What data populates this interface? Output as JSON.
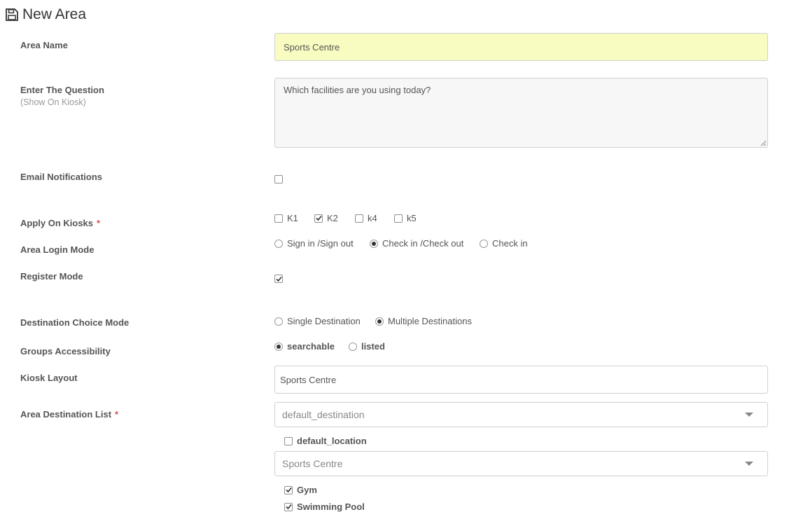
{
  "page": {
    "title": "New Area",
    "icon": "floppy-disk-icon"
  },
  "fields": {
    "area_name": {
      "label": "Area Name",
      "value": "Sports Centre"
    },
    "question": {
      "label": "Enter The Question",
      "sublabel": "(Show On Kiosk)",
      "value": "Which facilities are you using today?"
    },
    "email_notifications": {
      "label": "Email Notifications",
      "checked": false
    },
    "apply_on_kiosks": {
      "label": "Apply On Kiosks",
      "required_mark": "*",
      "options": [
        {
          "label": "K1",
          "checked": false
        },
        {
          "label": "K2",
          "checked": true
        },
        {
          "label": "k4",
          "checked": false
        },
        {
          "label": "k5",
          "checked": false
        }
      ]
    },
    "area_login_mode": {
      "label": "Area Login Mode",
      "options": [
        {
          "label": "Sign in /Sign out",
          "selected": false
        },
        {
          "label": "Check in /Check out",
          "selected": true
        },
        {
          "label": "Check in",
          "selected": false
        }
      ]
    },
    "register_mode": {
      "label": "Register Mode",
      "checked": true
    },
    "destination_choice_mode": {
      "label": "Destination Choice Mode",
      "options": [
        {
          "label": "Single Destination",
          "selected": false
        },
        {
          "label": "Multiple Destinations",
          "selected": true
        }
      ]
    },
    "groups_accessibility": {
      "label": "Groups Accessibility",
      "options": [
        {
          "label": "searchable",
          "selected": true
        },
        {
          "label": "listed",
          "selected": false
        }
      ]
    },
    "kiosk_layout": {
      "label": "Kiosk Layout",
      "value": "Sports Centre"
    },
    "area_destination_list": {
      "label": "Area Destination List",
      "required_mark": "*",
      "select1": {
        "value": "default_destination"
      },
      "location1": {
        "label": "default_location",
        "checked": false
      },
      "select2": {
        "value": "Sports Centre"
      },
      "facilities": [
        {
          "label": "Gym",
          "checked": true
        },
        {
          "label": "Swimming Pool",
          "checked": true
        }
      ]
    }
  },
  "colors": {
    "highlight_input": "#f8fcc0",
    "required": "#d9534f",
    "border": "#cfcfcf"
  }
}
